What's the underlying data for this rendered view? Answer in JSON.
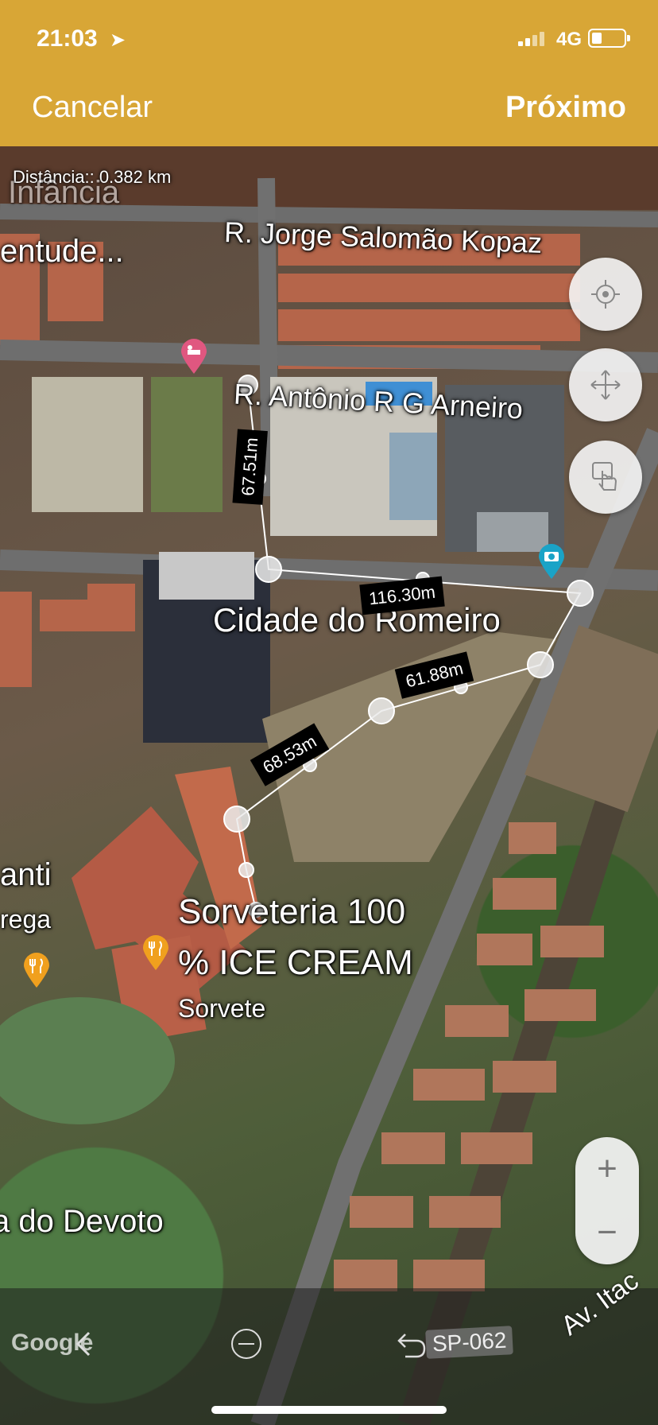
{
  "status_bar": {
    "time": "21:03",
    "network": "4G"
  },
  "header": {
    "cancel_label": "Cancelar",
    "next_label": "Próximo"
  },
  "map": {
    "distance_text": "Distância:: 0.382 km",
    "labels": {
      "infancia": "Infância",
      "juventude": "entude...",
      "street_jorge": "R. Jorge Salomão Kopaz",
      "street_antonio": "R. Antônio R G Arneiro",
      "cidade_romeiro": "Cidade do Romeiro",
      "anti": "anti",
      "rega": "rega",
      "sorveteria_1": "Sorveteria 100",
      "sorveteria_2": "% ICE CREAM",
      "sorvete": "Sorvete",
      "devoto": "a do Devoto",
      "avenue": "Av. Itac"
    },
    "segments": [
      "67.51m",
      "116.30m",
      "61.88m",
      "68.53m"
    ]
  },
  "controls": {
    "zoom_in": "+",
    "zoom_out": "−"
  },
  "bottom_bar": {
    "google": "Google",
    "road": "SP-062"
  },
  "colors": {
    "header": "#d8a636",
    "hotel_pin": "#e05780",
    "food_pin": "#f0a01e",
    "photo_pin": "#1aa3c7"
  },
  "icons": [
    "location-arrow-icon",
    "locate-icon",
    "move-icon",
    "touch-icon",
    "hotel-icon",
    "restaurant-icon",
    "camera-icon",
    "back-icon",
    "clear-icon",
    "undo-icon"
  ]
}
